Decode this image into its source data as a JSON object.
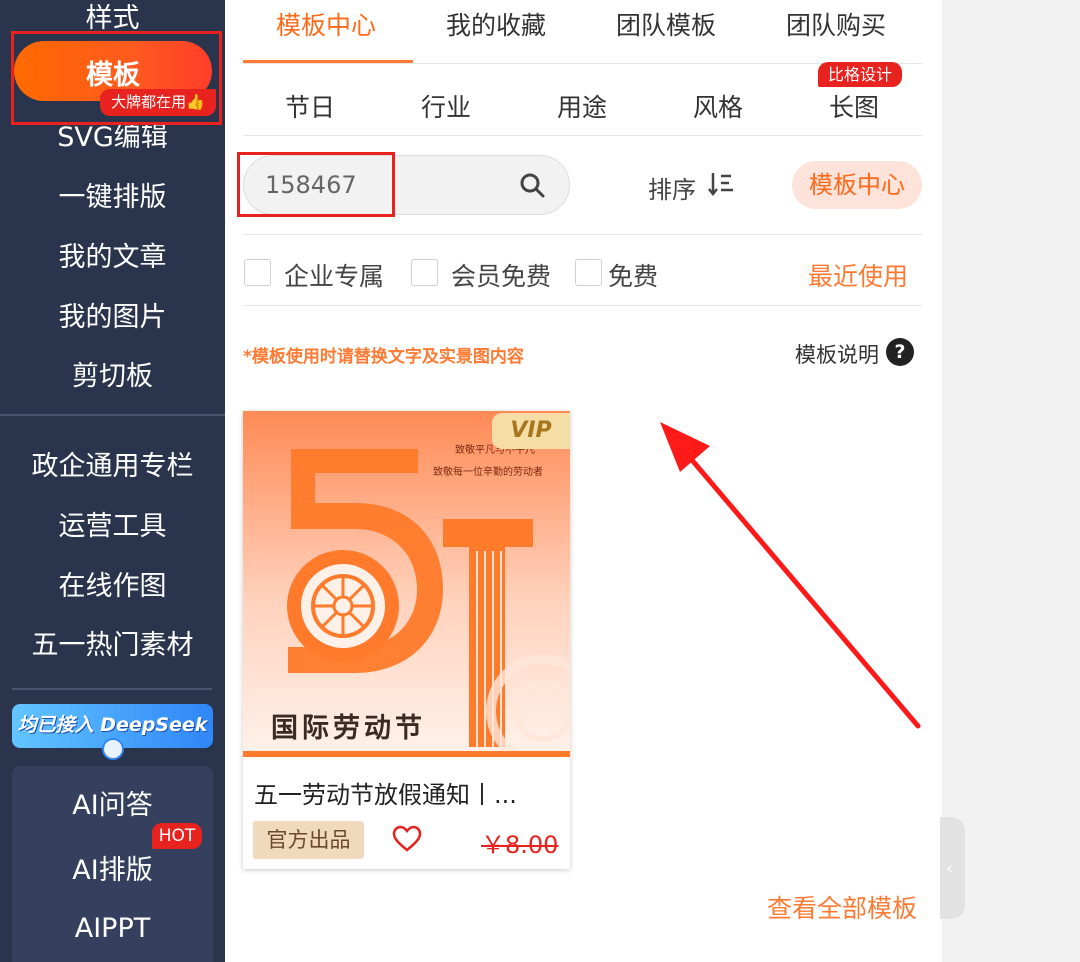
{
  "sidebar": {
    "items": {
      "style": "样式",
      "template": "模板",
      "template_badge": "大牌都在用👍",
      "svg_edit": "SVG编辑",
      "one_click": "一键排版",
      "my_articles": "我的文章",
      "my_images": "我的图片",
      "clipboard": "剪切板",
      "gov_column": "政企通用专栏",
      "ops_tools": "运营工具",
      "online_draw": "在线作图",
      "may_day": "五一热门素材"
    },
    "deepseek_banner": "均已接入 DeepSeek",
    "ai": {
      "qa": "AI问答",
      "layout": "AI排版",
      "layout_badge": "HOT",
      "ppt": "AIPPT"
    }
  },
  "top_tabs": [
    "模板中心",
    "我的收藏",
    "团队模板",
    "团队购买"
  ],
  "sub_tabs": [
    "节日",
    "行业",
    "用途",
    "风格",
    "长图"
  ],
  "sub_tab_badge": "比格设计",
  "search": {
    "value": "158467"
  },
  "sort_label": "排序",
  "center_button": "模板中心",
  "filters": [
    "企业专属",
    "会员免费",
    "免费"
  ],
  "recent": "最近使用",
  "notice": "*模板使用时请替换文字及实景图内容",
  "explain": "模板说明",
  "card": {
    "vip": "VIP",
    "poster_line1": "致敬平凡与不平凡",
    "poster_line2": "致敬每一位辛勤的劳动者",
    "poster_title": "国际劳动节",
    "title": "五一劳动节放假通知丨...",
    "official": "官方出品",
    "price": "￥8.00"
  },
  "view_all": "查看全部模板",
  "colors": {
    "accent": "#ff7a33",
    "sidebar": "#2b344d",
    "badge_red": "#e8231f"
  }
}
